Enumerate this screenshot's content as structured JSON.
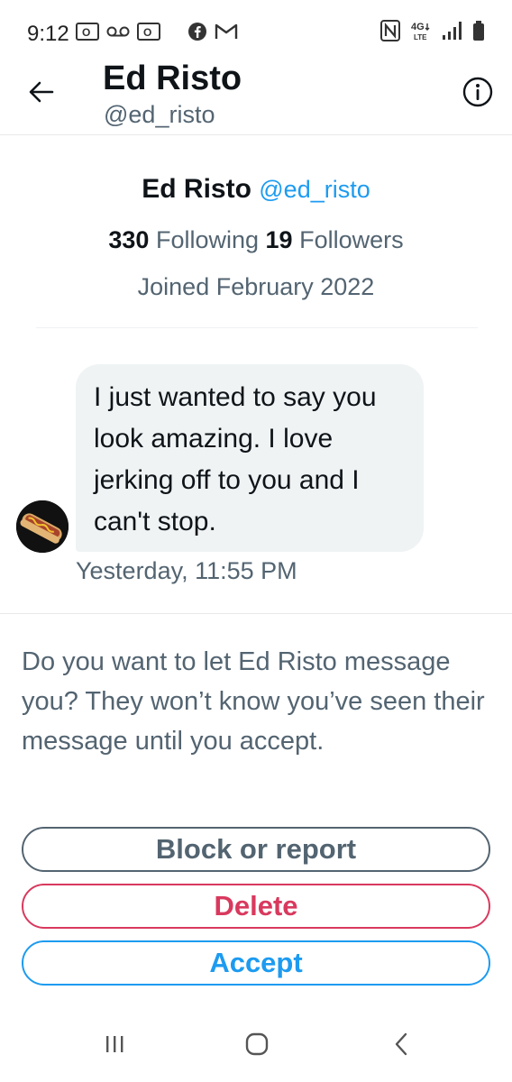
{
  "status_bar": {
    "time": "9:12",
    "left_icons": [
      "outlook-icon",
      "voicemail-icon",
      "outlook-icon",
      "facebook-icon",
      "gmail-icon"
    ],
    "right_icons": [
      "nfc-icon",
      "4g-lte-icon",
      "signal-icon",
      "battery-icon"
    ],
    "network_label": "4G LTE"
  },
  "header": {
    "name": "Ed Risto",
    "handle": "@ed_risto",
    "back_icon": "arrow-left-icon",
    "info_icon": "info-icon"
  },
  "profile": {
    "name": "Ed Risto",
    "handle": "@ed_risto",
    "following_count": "330",
    "following_label": "Following",
    "followers_count": "19",
    "followers_label": "Followers",
    "joined": "Joined February 2022"
  },
  "message": {
    "text": "I just wanted to say you look amazing. I love jerking off to you and I can't stop.",
    "timestamp": "Yesterday, 11:55 PM",
    "avatar": "hotdog-avatar"
  },
  "request": {
    "prompt": "Do you want to let Ed Risto message you? They won’t know you’ve seen their message until you accept.",
    "block_label": "Block or report",
    "delete_label": "Delete",
    "accept_label": "Accept"
  },
  "nav": {
    "icons": [
      "recent-apps-icon",
      "home-icon",
      "back-icon"
    ]
  },
  "colors": {
    "accent": "#1d9bf0",
    "danger": "#d9395e",
    "secondary_text": "#536471",
    "bubble_bg": "#eff3f4"
  }
}
